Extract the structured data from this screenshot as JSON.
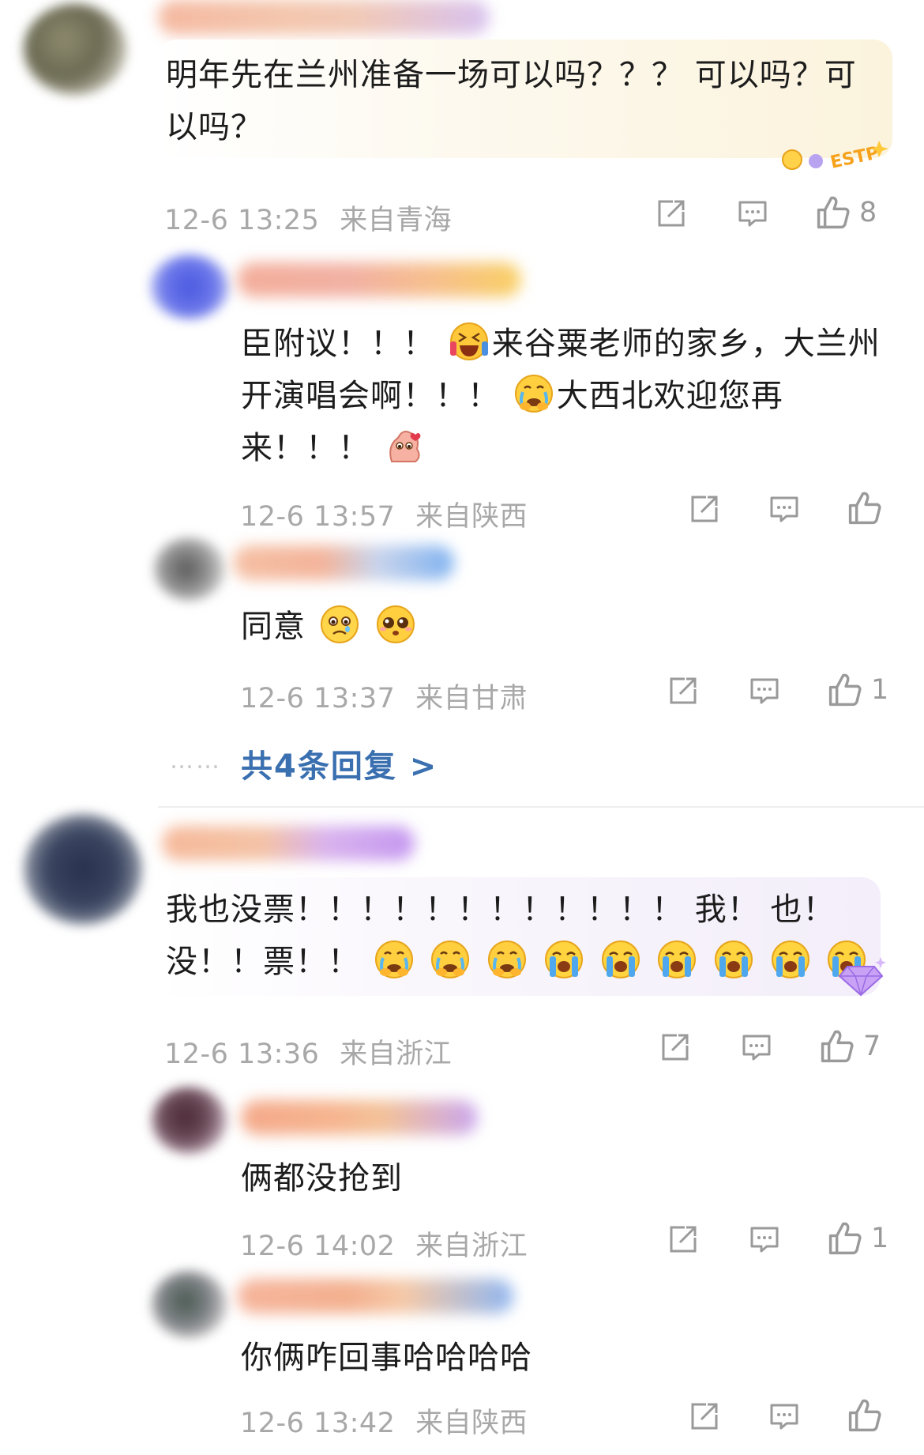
{
  "comments": [
    {
      "text": "明年先在兰州准备一场可以吗？？？ 可以吗？可以吗？",
      "time": "12-6 13:25",
      "location": "来自青海",
      "likes": "8",
      "badge": "ESTP",
      "replies": [
        {
          "text_1": "臣附议！！！",
          "text_2": "来谷粟老师的家乡，大兰州开演唱会啊！！！",
          "text_3": "大西北欢迎您再来！！！",
          "time": "12-6 13:57",
          "location": "来自陕西",
          "likes": ""
        },
        {
          "text": "同意",
          "time": "12-6 13:37",
          "location": "来自甘肃",
          "likes": "1"
        }
      ],
      "more_replies": "共4条回复 >",
      "dots": "……"
    },
    {
      "text": "我也没票！！！！！！！！！！！！ 我！ 也！ 没！！票！！",
      "time": "12-6 13:36",
      "location": "来自浙江",
      "likes": "7",
      "replies": [
        {
          "text": "俩都没抢到",
          "time": "12-6 14:02",
          "location": "来自浙江",
          "likes": "1"
        },
        {
          "text": "你俩咋回事哈哈哈哈",
          "time": "12-6 13:42",
          "location": "来自陕西",
          "likes": ""
        }
      ]
    }
  ],
  "icons": {
    "share": "share-icon",
    "comment": "comment-icon",
    "like": "thumbs-up-icon",
    "emoji_cry": "crying-face-emoji",
    "emoji_sob": "sobbing-face-emoji",
    "emoji_laugh": "laughing-face-emoji",
    "emoji_pleading": "pleading-face-emoji",
    "emoji_sad": "sad-face-emoji"
  },
  "colors": {
    "link": "#3a6fb0",
    "meta": "#a8a8a8",
    "bubble_1": "#fbf6e6",
    "bubble_2": "#f6f2fb"
  }
}
